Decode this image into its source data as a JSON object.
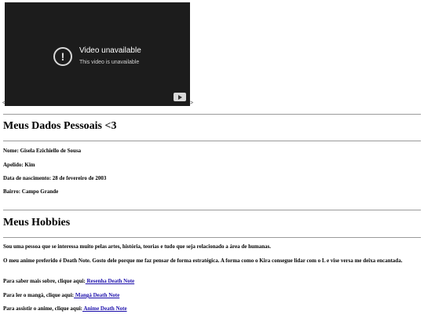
{
  "video": {
    "title": "Video unavailable",
    "subtitle": "This video is unavailable",
    "alert_glyph": "!"
  },
  "left_marker": "<",
  "right_marker": ">",
  "personal": {
    "heading": "Meus Dados Pessoais <3",
    "nome": "Nome: Gisela Ezichiello de Sousa",
    "apelido": "Apelido: Kim",
    "nascimento": "Data de nascimento: 28 de fevereiro de 2003",
    "bairro": "Bairro: Campo Grande"
  },
  "hobbies": {
    "heading": "Meus Hobbies",
    "intro": "Sou uma pessoa que se interessa muito pelas artes, história, teorias e tudo que seja relacionado a área de humanas.",
    "anime": "O meu anime preferido é Death Note. Gosto dele porque me faz pensar de forma estratégica. A forma como o Kira consegue lidar com o L e vise versa me deixa encantada.",
    "saber_prefix": "Para saber mais sobre, clique aqui:",
    "saber_link": " Resenha Death Note",
    "ler_prefix": "Para ler o mangá, clique aqui:",
    "ler_link": " Mangá Death Note",
    "assistir_prefix": "Para assistir o anime, clique aqui:",
    "assistir_link": " Anime Death Note"
  }
}
